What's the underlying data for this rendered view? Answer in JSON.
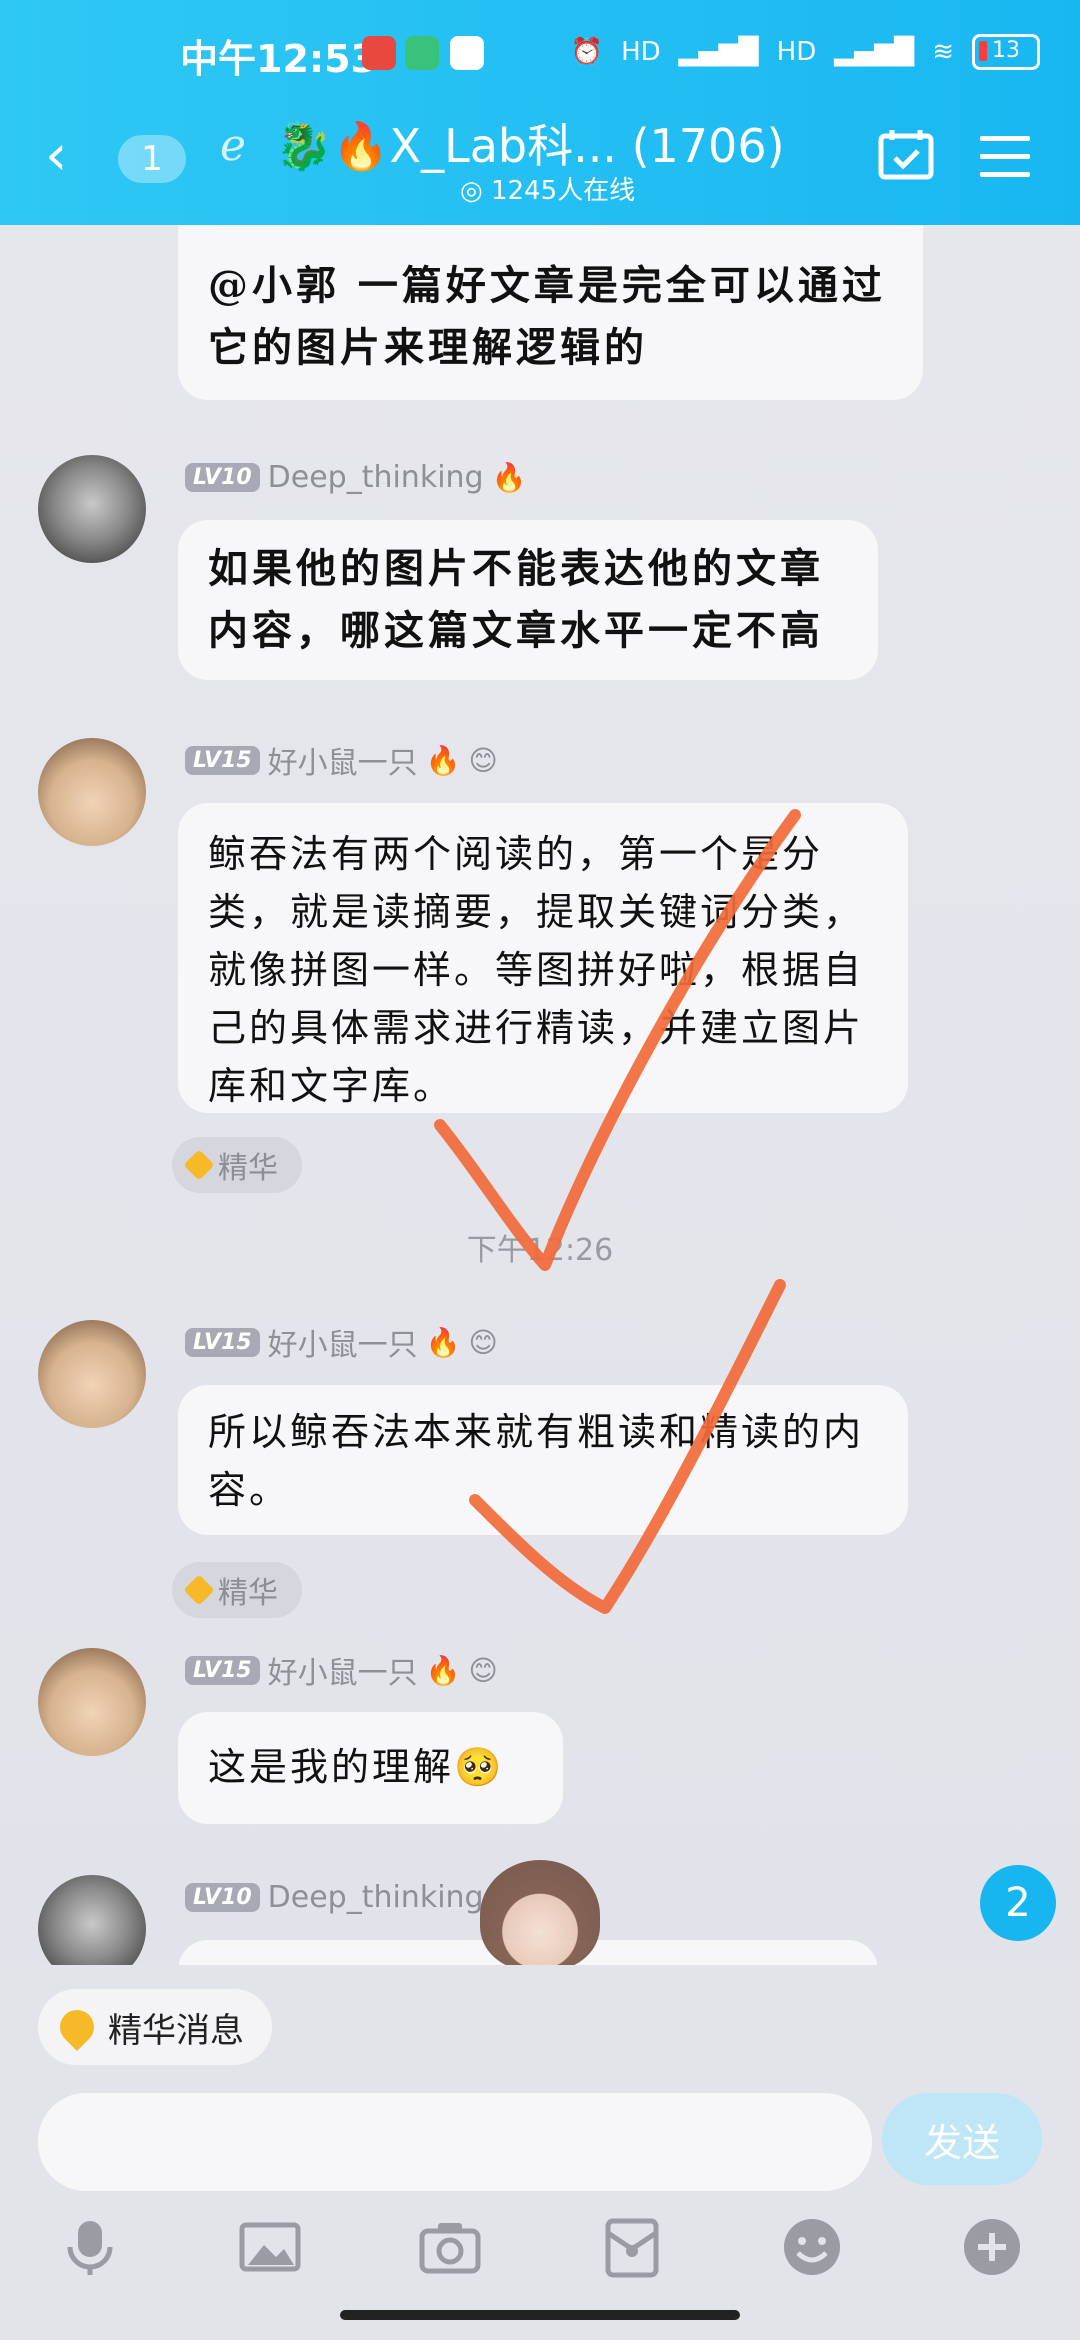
{
  "status_bar": {
    "time": "中午12:53",
    "network": "HD",
    "battery": "13"
  },
  "header": {
    "back_label": "‹",
    "unread_count": "1",
    "title": "🐉🔥X_Lab科... (1706)",
    "online": "1245人在线"
  },
  "messages": [
    {
      "text": "@小郭 一篇好文章是完全可以通过它的图片来理解逻辑的"
    },
    {
      "level": "LV10",
      "sender": "Deep_thinking",
      "text": "如果他的图片不能表达他的文章内容，哪这篇文章水平一定不高"
    },
    {
      "level": "LV15",
      "sender": "好小鼠一只",
      "text": "鲸吞法有两个阅读的，第一个是分类，就是读摘要，提取关键词分类，就像拼图一样。等图拼好啦，根据自己的具体需求进行精读，并建立图片库和文字库。",
      "tag": "精华"
    },
    {
      "timestamp": "下午12:26"
    },
    {
      "level": "LV15",
      "sender": "好小鼠一只",
      "text": "所以鲸吞法本来就有粗读和精读的内容。",
      "tag": "精华"
    },
    {
      "level": "LV15",
      "sender": "好小鼠一只",
      "text": "这是我的理解🥺"
    },
    {
      "level": "LV10",
      "sender": "Deep_thinking"
    }
  ],
  "unread_new": "2",
  "bottom": {
    "essence_button": "精华消息",
    "input_placeholder": "",
    "send_label": "发送"
  },
  "colors": {
    "header": "#1fbbf2",
    "checkmark": "#f26a3a",
    "send_disabled": "#bfe6f6"
  }
}
